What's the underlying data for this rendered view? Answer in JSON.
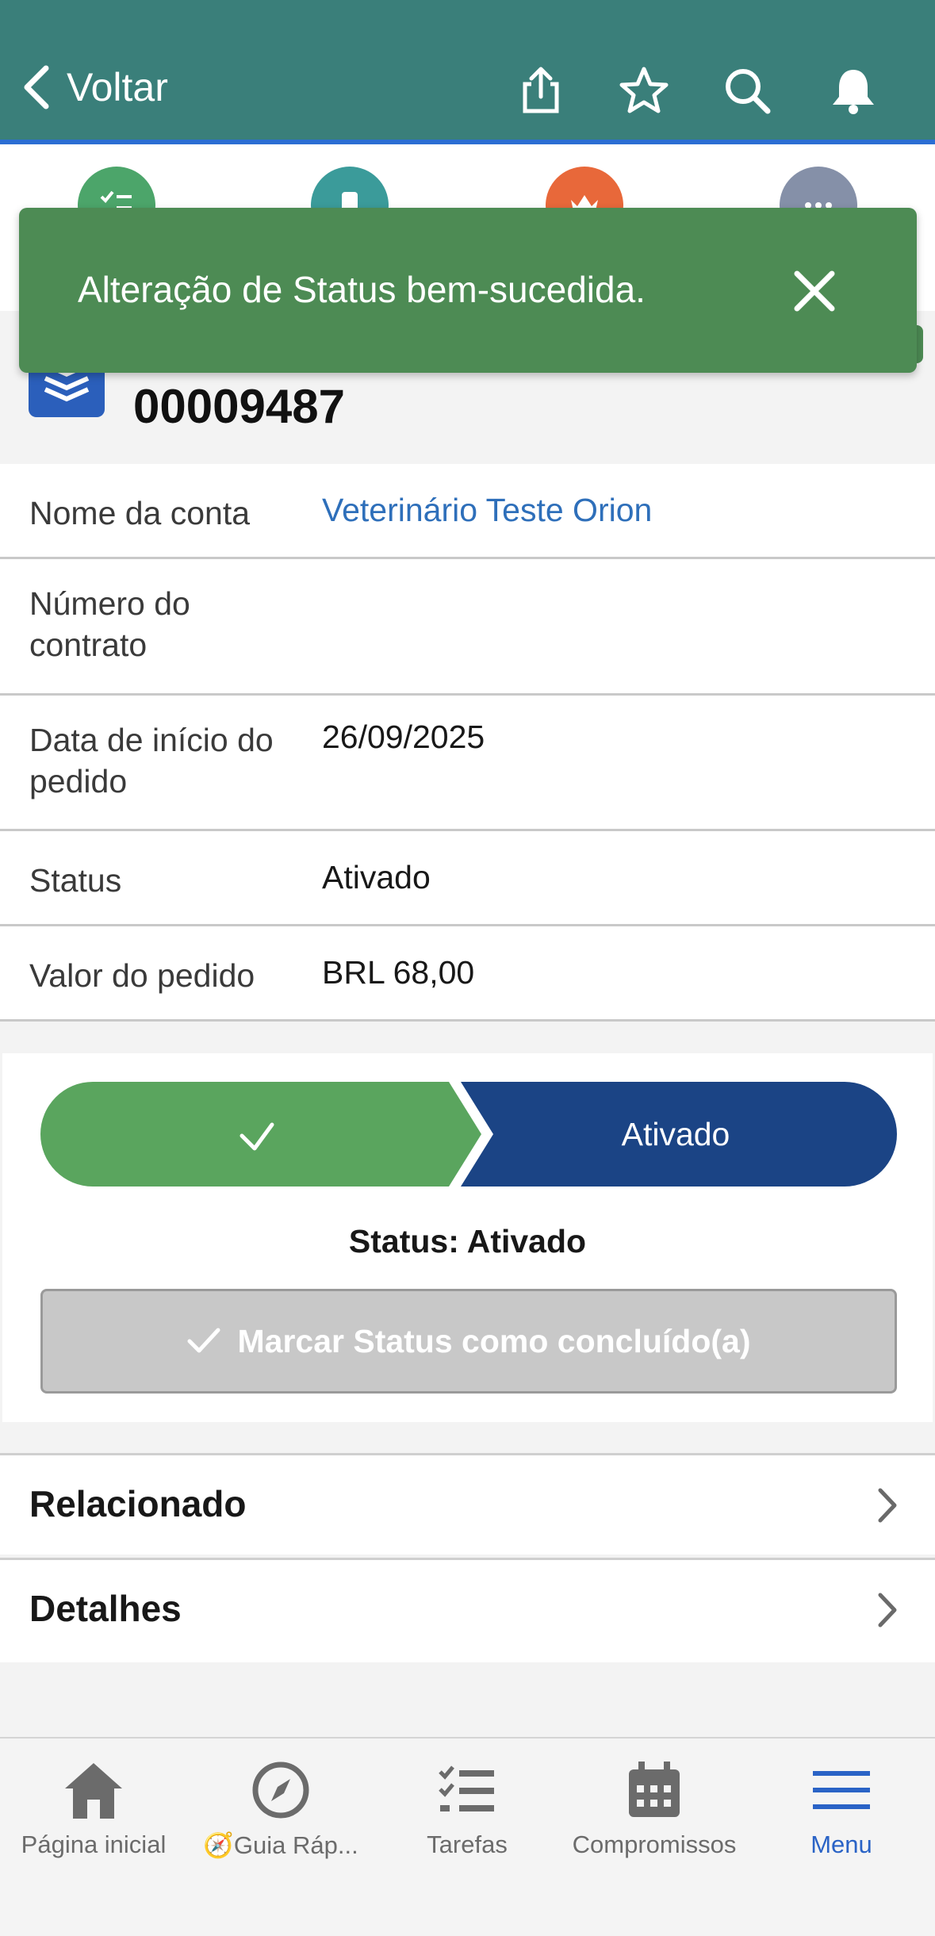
{
  "header": {
    "back_label": "Voltar"
  },
  "toast": {
    "message": "Alteração de Status bem-sucedida."
  },
  "record": {
    "number": "00009487"
  },
  "fields": [
    {
      "label": "Nome da conta",
      "value": "Veterinário Teste Orion"
    },
    {
      "label": "Número do contrato",
      "value": ""
    },
    {
      "label": "Data de início do pedido",
      "value": "26/09/2025"
    },
    {
      "label": "Status",
      "value": "Ativado"
    },
    {
      "label": "Valor do pedido",
      "value": "BRL 68,00"
    }
  ],
  "path": {
    "current_stage": "Ativado",
    "status_text": "Status: Ativado",
    "mark_button": "Marcar Status como concluído(a)"
  },
  "sections": [
    {
      "title": "Relacionado"
    },
    {
      "title": "Detalhes"
    }
  ],
  "tabbar": [
    {
      "label": "Página inicial",
      "icon": "home-icon"
    },
    {
      "label": "🧭Guia Ráp...",
      "icon": "compass-icon"
    },
    {
      "label": "Tarefas",
      "icon": "tasks-icon"
    },
    {
      "label": "Compromissos",
      "icon": "calendar-icon"
    },
    {
      "label": "Menu",
      "icon": "menu-icon",
      "active": true
    }
  ],
  "colors": {
    "header": "#3a7f7a",
    "toast": "#4d8b54",
    "path_complete": "#5aa55e",
    "path_current": "#1b4485",
    "link": "#2e6fba",
    "active_tab": "#2a63c6"
  }
}
